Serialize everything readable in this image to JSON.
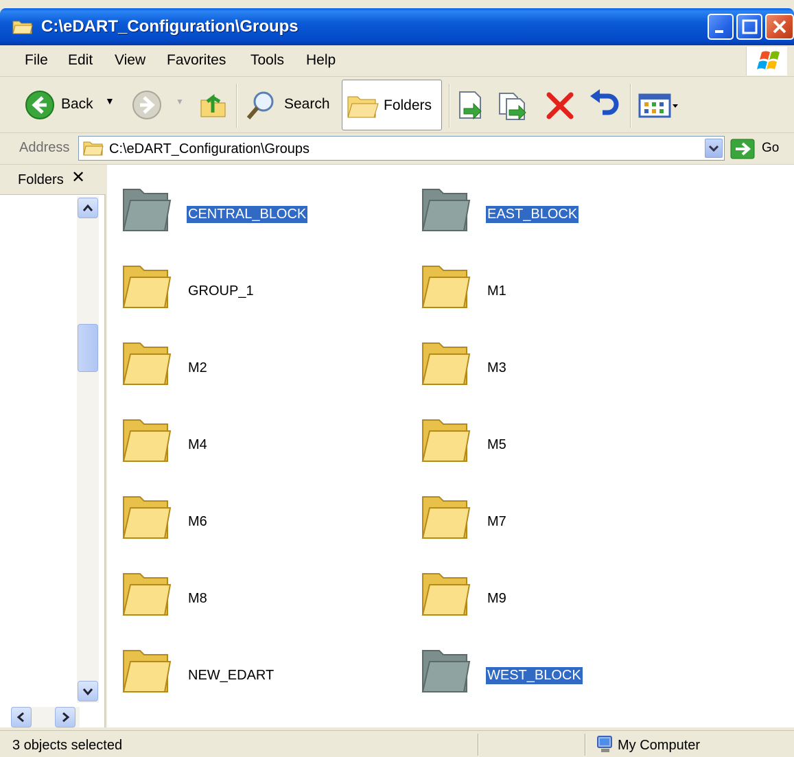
{
  "window": {
    "title": "C:\\eDART_Configuration\\Groups"
  },
  "menu": [
    "File",
    "Edit",
    "View",
    "Favorites",
    "Tools",
    "Help"
  ],
  "toolbar": {
    "back_label": "Back",
    "search_label": "Search",
    "folders_label": "Folders"
  },
  "address": {
    "label": "Address",
    "value": "C:\\eDART_Configuration\\Groups",
    "go_label": "Go"
  },
  "folders_pane": {
    "title": "Folders"
  },
  "items": [
    {
      "name": "CENTRAL_BLOCK",
      "selected": true
    },
    {
      "name": "EAST_BLOCK",
      "selected": true
    },
    {
      "name": "GROUP_1",
      "selected": false
    },
    {
      "name": "M1",
      "selected": false
    },
    {
      "name": "M2",
      "selected": false
    },
    {
      "name": "M3",
      "selected": false
    },
    {
      "name": "M4",
      "selected": false
    },
    {
      "name": "M5",
      "selected": false
    },
    {
      "name": "M6",
      "selected": false
    },
    {
      "name": "M7",
      "selected": false
    },
    {
      "name": "M8",
      "selected": false
    },
    {
      "name": "M9",
      "selected": false
    },
    {
      "name": "NEW_EDART",
      "selected": false
    },
    {
      "name": "WEST_BLOCK",
      "selected": true
    }
  ],
  "status": {
    "selection": "3 objects selected",
    "zone": "My Computer"
  },
  "colors": {
    "selection": "#316ac5",
    "titlebar": "#0b5ad6",
    "folder": "#f6d56a"
  }
}
